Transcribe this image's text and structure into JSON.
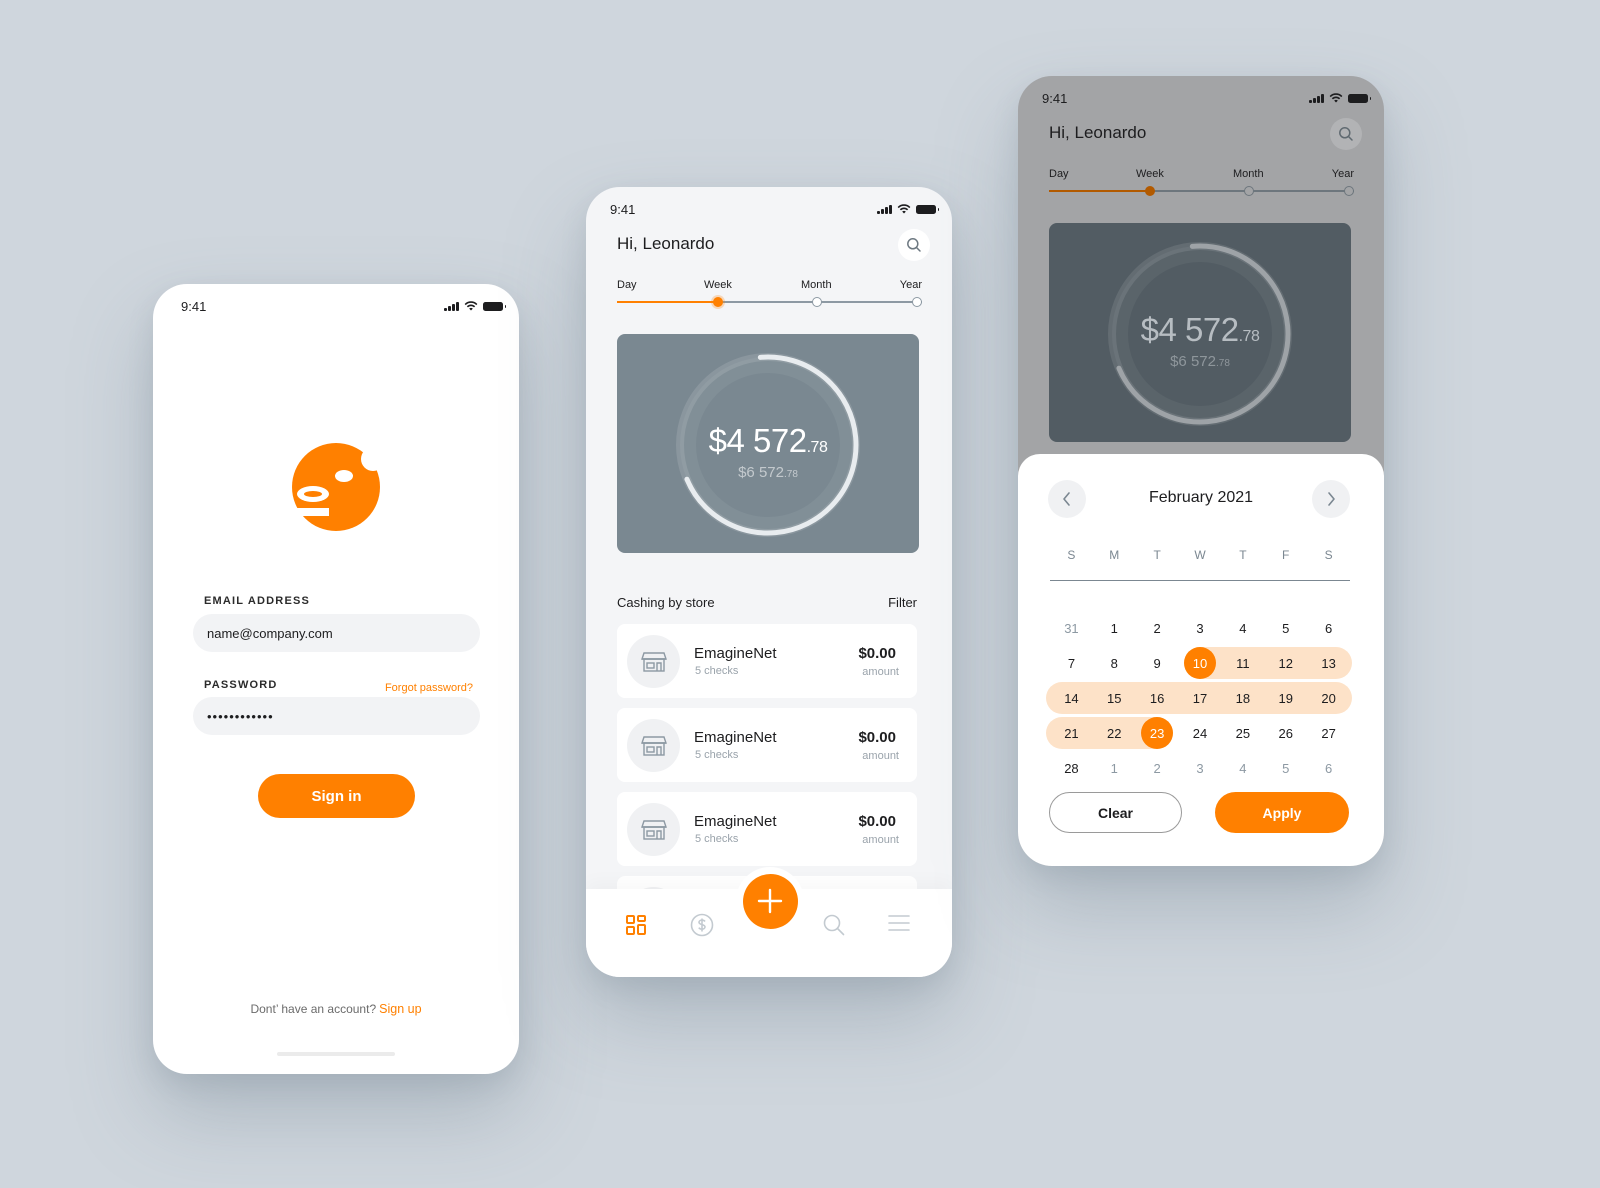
{
  "theme": {
    "accent": "#ff8000",
    "background": "#cfd6dd"
  },
  "status_bar": {
    "time": "9:41",
    "icons": [
      "cellular-signal-icon",
      "wifi-icon",
      "battery-icon"
    ]
  },
  "login": {
    "logo": "brand-logo",
    "email": {
      "label": "EMAIL ADDRESS",
      "value": "name@company.com"
    },
    "password": {
      "label": "PASSWORD",
      "value": "••••••••••••",
      "forgot_link": "Forgot password?"
    },
    "sign_in_button": "Sign in",
    "signup_prompt": "Dont’ have an account?",
    "signup_link": "Sign up"
  },
  "dashboard": {
    "greeting": "Hi, Leonardo",
    "period_selector": {
      "options": [
        "Day",
        "Week",
        "Month",
        "Year"
      ],
      "selected": "Week"
    },
    "summary": {
      "amount_main": "$4 572",
      "amount_main_cents": ".78",
      "amount_total": "$6 572",
      "amount_total_cents": ".78",
      "progress_fraction": 0.7
    },
    "section_title": "Cashing by store",
    "filter_label": "Filter",
    "stores": [
      {
        "name": "EmagineNet",
        "checks": "5 checks",
        "amount": "$0.00",
        "amount_label": "amount"
      },
      {
        "name": "EmagineNet",
        "checks": "5 checks",
        "amount": "$0.00",
        "amount_label": "amount"
      },
      {
        "name": "EmagineNet",
        "checks": "5 checks",
        "amount": "$0.00",
        "amount_label": "amount"
      }
    ],
    "bottom_nav": [
      {
        "name": "dashboard",
        "icon": "grid-icon",
        "active": true
      },
      {
        "name": "payments",
        "icon": "dollar-circle-icon",
        "active": false
      },
      {
        "name": "add",
        "icon": "plus-icon",
        "active": false
      },
      {
        "name": "search",
        "icon": "search-icon",
        "active": false
      },
      {
        "name": "menu",
        "icon": "menu-icon",
        "active": false
      }
    ]
  },
  "calendar": {
    "month_title": "February 2021",
    "weekdays": [
      "S",
      "M",
      "T",
      "W",
      "T",
      "F",
      "S"
    ],
    "weeks": [
      [
        {
          "d": "31",
          "muted": true
        },
        {
          "d": "1"
        },
        {
          "d": "2"
        },
        {
          "d": "3"
        },
        {
          "d": "4"
        },
        {
          "d": "5"
        },
        {
          "d": "6"
        }
      ],
      [
        {
          "d": "7"
        },
        {
          "d": "8"
        },
        {
          "d": "9"
        },
        {
          "d": "10",
          "selected": true
        },
        {
          "d": "11"
        },
        {
          "d": "12"
        },
        {
          "d": "13"
        }
      ],
      [
        {
          "d": "14"
        },
        {
          "d": "15"
        },
        {
          "d": "16"
        },
        {
          "d": "17"
        },
        {
          "d": "18"
        },
        {
          "d": "19"
        },
        {
          "d": "20"
        }
      ],
      [
        {
          "d": "21"
        },
        {
          "d": "22"
        },
        {
          "d": "23",
          "selected": true
        },
        {
          "d": "24"
        },
        {
          "d": "25"
        },
        {
          "d": "26"
        },
        {
          "d": "27"
        }
      ],
      [
        {
          "d": "28"
        },
        {
          "d": "1",
          "muted": true
        },
        {
          "d": "2",
          "muted": true
        },
        {
          "d": "3",
          "muted": true
        },
        {
          "d": "4",
          "muted": true
        },
        {
          "d": "5",
          "muted": true
        },
        {
          "d": "6",
          "muted": true
        }
      ]
    ],
    "range_start": "10",
    "range_end": "23",
    "clear_button": "Clear",
    "apply_button": "Apply"
  }
}
